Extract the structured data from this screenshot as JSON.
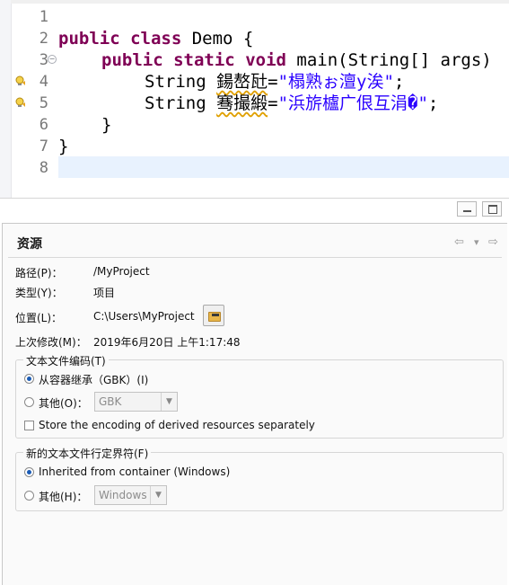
{
  "editor": {
    "line_numbers": [
      "1",
      "2",
      "3",
      "4",
      "5",
      "6",
      "7",
      "8"
    ],
    "code": {
      "l2_kw1": "public",
      "l2_kw2": "class",
      "l2_rest": " Demo {",
      "l3_kw1": "public",
      "l3_kw2": "static",
      "l3_kw3": "void",
      "l3_rest": " main(String[] args)",
      "l4_type": "String",
      "l4_var": "鍚嶅瓧",
      "l4_eq": "=",
      "l4_str": "\"榻熟ぉ澶у涘\"",
      "l4_end": ";",
      "l5_type": "String",
      "l5_var": "骞撮緞",
      "l5_eq": "=",
      "l5_str": "\"浜旂櫨广佷互涓�\"",
      "l5_end": ";",
      "l6": "}",
      "l7": "}"
    }
  },
  "properties": {
    "title": "资源",
    "nav": {
      "back": "⇦",
      "menu": "▾",
      "forward": "⇨"
    },
    "path_label": "路径(P)：",
    "path_value": "/MyProject",
    "type_label": "类型(Y)：",
    "type_value": "项目",
    "location_label": "位置(L)：",
    "location_value": "C:\\Users\\MyProject",
    "modified_label": "上次修改(M)：",
    "modified_value": "2019年6月20日 上午1:17:48",
    "encoding_group": {
      "title": "文本文件编码(T)",
      "inherit_label": "从容器继承（GBK）(I)",
      "other_label": "其他(O)：",
      "other_value": "GBK",
      "store_label": "Store the encoding of derived resources separately"
    },
    "delimiter_group": {
      "title": "新的文本文件行定界符(F)",
      "inherit_label": "Inherited from container (Windows)",
      "other_label": "其他(H)：",
      "other_value": "Windows"
    }
  }
}
